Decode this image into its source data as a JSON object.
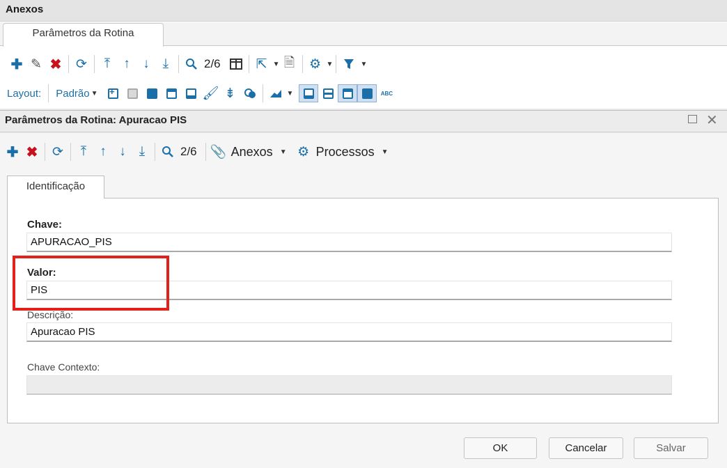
{
  "outer": {
    "title": "Anexos",
    "tab": "Parâmetros da Rotina",
    "record_counter": "2/6",
    "layout_label": "Layout:",
    "layout_value": "Padrão",
    "abc_label": "ABC"
  },
  "dialog": {
    "title": "Parâmetros da Rotina: Apuracao PIS",
    "record_counter": "2/6",
    "anexos_menu": "Anexos",
    "processos_menu": "Processos",
    "tab": "Identificação"
  },
  "form": {
    "chave_label": "Chave:",
    "chave_value": "APURACAO_PIS",
    "valor_label": "Valor:",
    "valor_value": "PIS",
    "descricao_label": "Descrição:",
    "descricao_value": "Apuracao PIS",
    "chave_contexto_label": "Chave Contexto:",
    "chave_contexto_value": ""
  },
  "buttons": {
    "ok": "OK",
    "cancel": "Cancelar",
    "save": "Salvar"
  },
  "colors": {
    "accent_blue": "#1b6fa8",
    "delete_red": "#c8101f",
    "highlight_red": "#e2211b"
  }
}
